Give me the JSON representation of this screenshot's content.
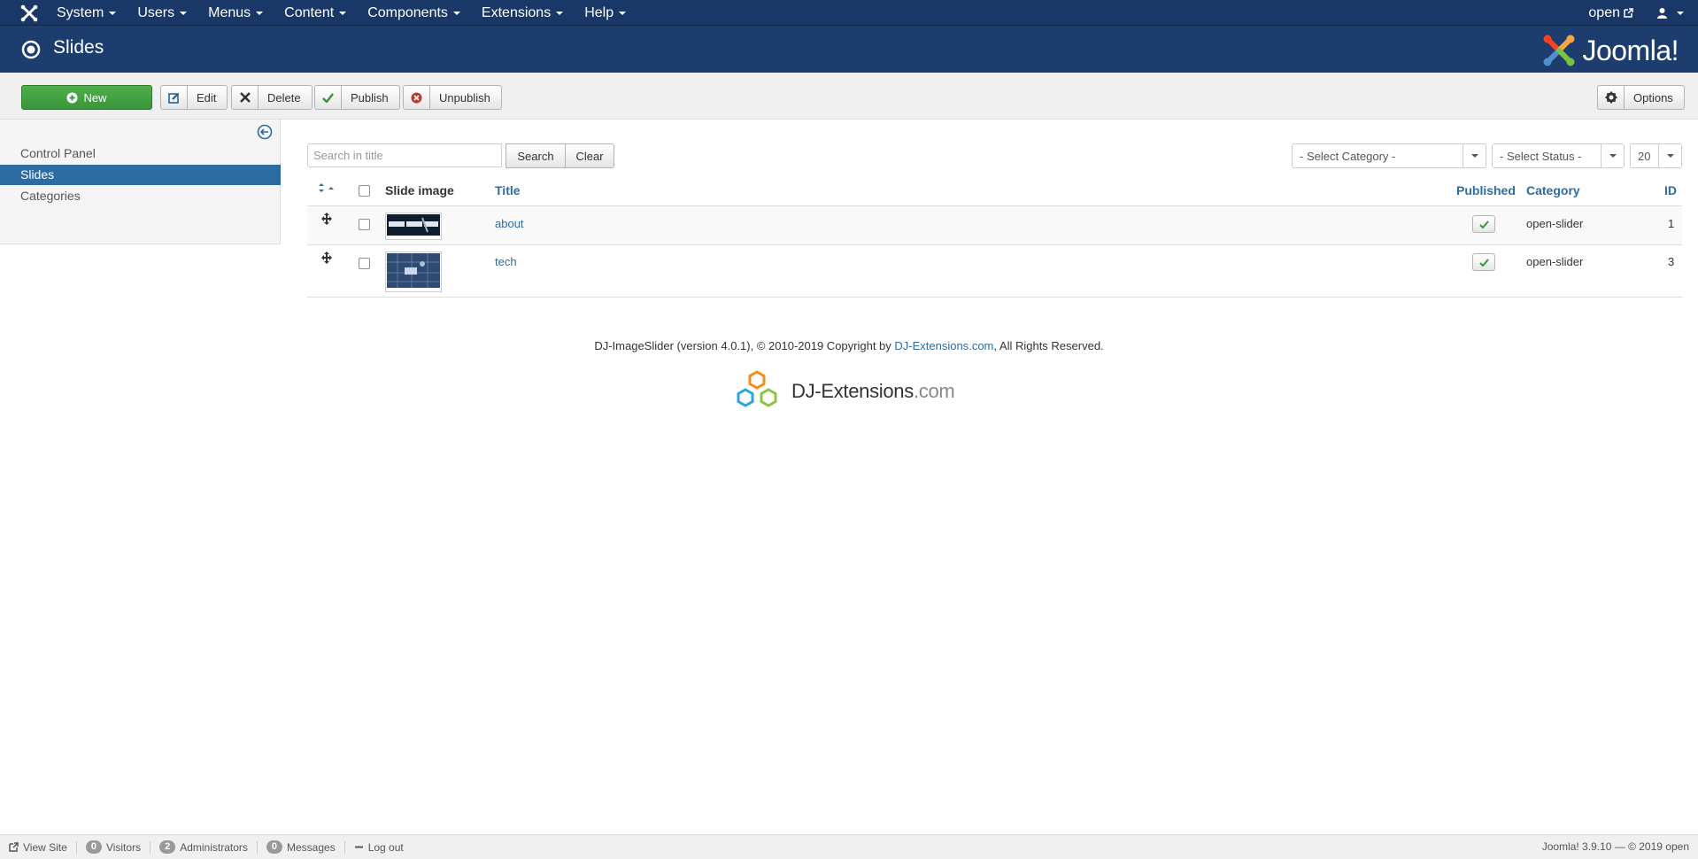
{
  "topnav": {
    "menus": [
      {
        "label": "System"
      },
      {
        "label": "Users"
      },
      {
        "label": "Menus"
      },
      {
        "label": "Content"
      },
      {
        "label": "Components"
      },
      {
        "label": "Extensions"
      },
      {
        "label": "Help"
      }
    ],
    "site_link": "open"
  },
  "header": {
    "title": "Slides",
    "brand": "Joomla!"
  },
  "toolbar": {
    "new_label": "New",
    "edit_label": "Edit",
    "delete_label": "Delete",
    "publish_label": "Publish",
    "unpublish_label": "Unpublish",
    "options_label": "Options"
  },
  "sidebar": {
    "items": [
      {
        "label": "Control Panel",
        "active": false
      },
      {
        "label": "Slides",
        "active": true
      },
      {
        "label": "Categories",
        "active": false
      }
    ]
  },
  "filters": {
    "search_placeholder": "Search in title",
    "search_value": "",
    "search_button": "Search",
    "clear_button": "Clear",
    "category_select": "- Select Category -",
    "status_select": "- Select Status -",
    "limit_select": "20"
  },
  "table": {
    "columns": {
      "slide_image": "Slide image",
      "title": "Title",
      "published": "Published",
      "category": "Category",
      "id": "ID"
    },
    "rows": [
      {
        "title": "about",
        "published": true,
        "category": "open-slider",
        "id": "1"
      },
      {
        "title": "tech",
        "published": true,
        "category": "open-slider",
        "id": "3"
      }
    ]
  },
  "credits": {
    "text_before": "DJ-ImageSlider (version 4.0.1), © 2010-2019 Copyright by ",
    "link": "DJ-Extensions.com",
    "text_after": ", All Rights Reserved.",
    "logo_main": "DJ-Extensions",
    "logo_suffix": ".com"
  },
  "statusbar": {
    "view_site": "View Site",
    "visitors_count": "0",
    "visitors_label": "Visitors",
    "admins_count": "2",
    "admins_label": "Administrators",
    "messages_count": "0",
    "messages_label": "Messages",
    "logout": "Log out",
    "version": "Joomla! 3.9.10 — © 2019 open"
  },
  "colors": {
    "topnav_bg": "#1a3867",
    "header_bg": "#1c3d6e",
    "accent": "#2d6ca2",
    "new_button": "#3a963a"
  }
}
